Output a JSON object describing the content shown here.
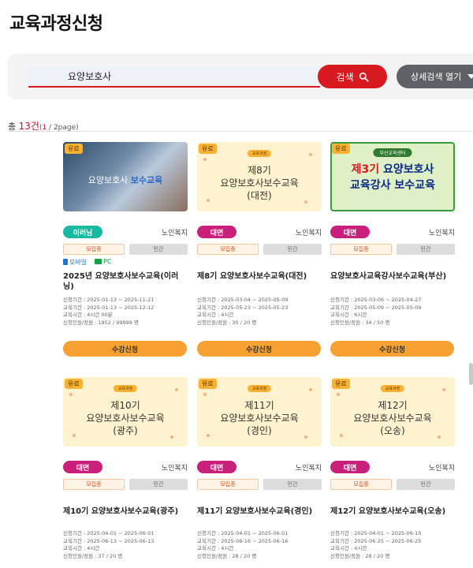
{
  "page": {
    "title": "교육과정신청"
  },
  "search": {
    "query": "요양보호사",
    "button_label": "검색",
    "detail_label": "상세검색 열기"
  },
  "results": {
    "prefix": "총 ",
    "count": "13건",
    "open": "(",
    "current_page": "1",
    "page_rest": " / 2page)"
  },
  "courses": [
    {
      "paid_tag": "유료",
      "thumb": {
        "style": "photo",
        "text": "요양보호사",
        "highlight": "보수교육"
      },
      "mode": "이러닝",
      "category": "노인복지",
      "status": "모집중",
      "type": "민간",
      "devices": [
        "모바일",
        "PC"
      ],
      "title": "2025년 요양보호사보수교육(이러닝)",
      "info": [
        "신청기간 : 2025-01-13 ~ 2025-11-21",
        "교육기간 : 2025-01-13 ~ 2025-12-12",
        "교육시간 : 4시간 00분",
        "신청인원/정원 : 1952 / 99999 명"
      ],
      "apply_label": "수강신청"
    },
    {
      "paid_tag": "유료",
      "thumb": {
        "style": "cream",
        "badge": "교육과정",
        "lines": [
          "제8기",
          "요양보호사보수교육",
          "(대전)"
        ]
      },
      "mode": "대면",
      "category": "노인복지",
      "status": "모집중",
      "type": "민간",
      "title": "제8기 요양보호사보수교육(대전)",
      "info": [
        "신청기간 : 2025-03-04 ~ 2025-05-09",
        "교육기간 : 2025-05-23 ~ 2025-05-23",
        "교육시간 : 4시간",
        "신청인원/정원 : 30 / 20 명"
      ],
      "apply_label": "수강신청"
    },
    {
      "paid_tag": "유료",
      "thumb": {
        "style": "green",
        "badge": "부산교육센터",
        "line1_num": "제3기",
        "line1_rest": " 요양보호사",
        "line2": "교육강사 보수교육"
      },
      "mode": "대면",
      "category": "노인복지",
      "status": "모집중",
      "type": "민간",
      "title": "요양보호사교육강사보수교육(부산)",
      "info": [
        "신청기간 : 2025-03-06 ~ 2025-04-27",
        "교육기간 : 2025-05-09 ~ 2025-05-09",
        "교육시간 : 6시간",
        "신청인원/정원 : 34 / 50 명"
      ],
      "apply_label": "수강신청"
    },
    {
      "paid_tag": "유료",
      "thumb": {
        "style": "cream",
        "badge": "교육과정",
        "lines": [
          "제10기",
          "요양보호사보수교육",
          "(광주)"
        ]
      },
      "mode": "대면",
      "category": "노인복지",
      "status": "모집중",
      "type": "민간",
      "title": "제10기 요양보호사보수교육(광주)",
      "info": [
        "신청기간 : 2025-04-01 ~ 2025-06-01",
        "교육기간 : 2025-06-13 ~ 2025-06-13",
        "교육시간 : 4시간",
        "신청인원/정원 : 37 / 20 명"
      ]
    },
    {
      "paid_tag": "유료",
      "thumb": {
        "style": "cream",
        "badge": "교육과정",
        "lines": [
          "제11기",
          "요양보호사보수교육",
          "(경인)"
        ]
      },
      "mode": "대면",
      "category": "노인복지",
      "status": "모집중",
      "type": "민간",
      "title": "제11기 요양보호사보수교육(경인)",
      "info": [
        "신청기간 : 2025-04-01 ~ 2025-06-01",
        "교육기간 : 2025-06-16 ~ 2025-06-16",
        "교육시간 : 4시간",
        "신청인원/정원 : 28 / 20 명"
      ]
    },
    {
      "paid_tag": "유료",
      "thumb": {
        "style": "cream",
        "badge": "교육과정",
        "lines": [
          "제12기",
          "요양보호사보수교육",
          "(오송)"
        ]
      },
      "mode": "대면",
      "category": "노인복지",
      "status": "모집중",
      "type": "민간",
      "title": "제12기 요양보호사보수교육(오송)",
      "info": [
        "신청기간 : 2025-04-01 ~ 2025-06-15",
        "교육기간 : 2025-06-25 ~ 2025-06-25",
        "교육시간 : 4시간",
        "신청인원/정원 : 28 / 20 명"
      ]
    }
  ],
  "colors": {
    "accent": "#d71920",
    "online": "#19b8a0",
    "face": "#c9207c",
    "apply": "#f7a133"
  }
}
